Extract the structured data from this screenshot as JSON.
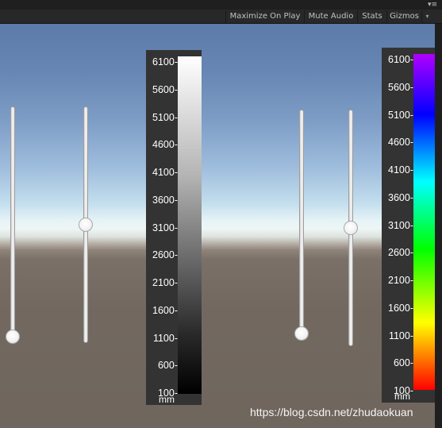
{
  "toolbar": {
    "maximize_label": "Maximize On Play",
    "mute_label": "Mute Audio",
    "stats_label": "Stats",
    "gizmos_label": "Gizmos",
    "gizmos_dropdown_glyph": "▾",
    "menu_glyph": "▾≡"
  },
  "sliders": [
    {
      "name": "slider-1",
      "value": 0.0
    },
    {
      "name": "slider-2",
      "value": 0.5
    },
    {
      "name": "slider-3",
      "value": 0.0
    },
    {
      "name": "slider-4",
      "value": 0.5
    }
  ],
  "grayscale_bar": {
    "ticks": [
      "6100-",
      "5600-",
      "5100-",
      "4600-",
      "4100-",
      "3600-",
      "3100-",
      "2600-",
      "2100-",
      "1600-",
      "1100-",
      "600-",
      "100-"
    ],
    "unit": "mm",
    "colors": {
      "top": "#ffffff",
      "bottom": "#000000"
    }
  },
  "color_bar": {
    "ticks": [
      "6100-",
      "5600-",
      "5100-",
      "4600-",
      "4100-",
      "3600-",
      "3100-",
      "2600-",
      "2100-",
      "1600-",
      "1100-",
      "600-",
      "100-"
    ],
    "unit": "mm",
    "colors": {
      "top": "#b000ff",
      "blue": "#0000ff",
      "cyan": "#00ffff",
      "green": "#00ff00",
      "yellow": "#ffff00",
      "bottom": "#ff0000"
    }
  },
  "watermark": "https://blog.csdn.net/zhudaokuan"
}
